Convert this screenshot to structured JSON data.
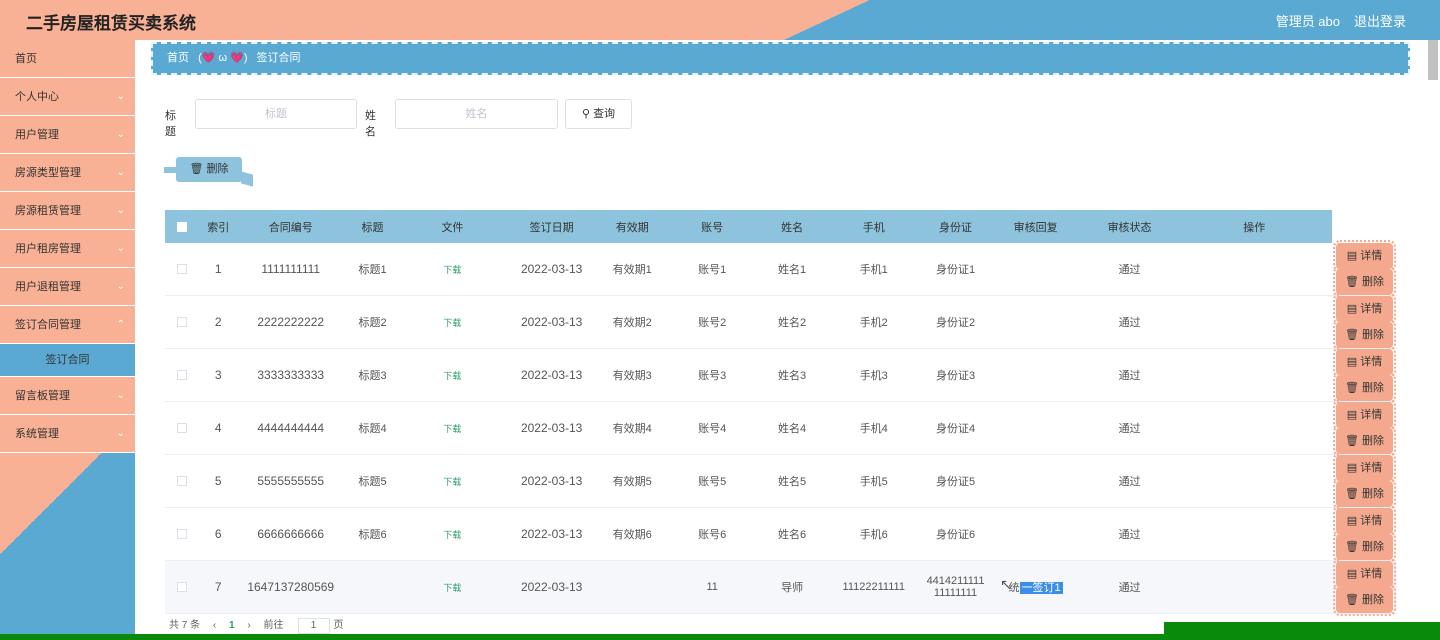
{
  "header": {
    "title": "二手房屋租赁买卖系统",
    "user": "管理员 abo",
    "logout": "退出登录"
  },
  "sidebar": {
    "items": [
      {
        "label": "首页",
        "chevron": false
      },
      {
        "label": "个人中心",
        "chevron": true
      },
      {
        "label": "用户管理",
        "chevron": true
      },
      {
        "label": "房源类型管理",
        "chevron": true
      },
      {
        "label": "房源租赁管理",
        "chevron": true
      },
      {
        "label": "用户租房管理",
        "chevron": true
      },
      {
        "label": "用户退租管理",
        "chevron": true
      },
      {
        "label": "签订合同管理",
        "chevron": true
      }
    ],
    "subitem": "签订合同",
    "items_after": [
      {
        "label": "留言板管理",
        "chevron": true
      },
      {
        "label": "系统管理",
        "chevron": true
      }
    ]
  },
  "breadcrumb": {
    "home": "首页",
    "deco": "(💗 ω 💗)",
    "current": "签订合同"
  },
  "search": {
    "title_label": "标题",
    "title_placeholder": "标题",
    "name_label": "姓名",
    "name_placeholder": "姓名",
    "query_label": "查询"
  },
  "toolbar": {
    "delete_label": "删除"
  },
  "table": {
    "headers": [
      "索引",
      "合同编号",
      "标题",
      "文件",
      "签订日期",
      "有效期",
      "账号",
      "姓名",
      "手机",
      "身份证",
      "审核回复",
      "审核状态",
      "操作"
    ],
    "download_label": "下载",
    "detail_label": "详情",
    "delete_label": "删除",
    "rows": [
      {
        "idx": "1",
        "contract": "1111111111",
        "title": "标题1",
        "date": "2022-03-13",
        "valid": "有效期1",
        "account": "账号1",
        "name": "姓名1",
        "phone": "手机1",
        "idcard": "身份证1",
        "reply": "",
        "status": "通过"
      },
      {
        "idx": "2",
        "contract": "2222222222",
        "title": "标题2",
        "date": "2022-03-13",
        "valid": "有效期2",
        "account": "账号2",
        "name": "姓名2",
        "phone": "手机2",
        "idcard": "身份证2",
        "reply": "",
        "status": "通过"
      },
      {
        "idx": "3",
        "contract": "3333333333",
        "title": "标题3",
        "date": "2022-03-13",
        "valid": "有效期3",
        "account": "账号3",
        "name": "姓名3",
        "phone": "手机3",
        "idcard": "身份证3",
        "reply": "",
        "status": "通过"
      },
      {
        "idx": "4",
        "contract": "4444444444",
        "title": "标题4",
        "date": "2022-03-13",
        "valid": "有效期4",
        "account": "账号4",
        "name": "姓名4",
        "phone": "手机4",
        "idcard": "身份证4",
        "reply": "",
        "status": "通过"
      },
      {
        "idx": "5",
        "contract": "5555555555",
        "title": "标题5",
        "date": "2022-03-13",
        "valid": "有效期5",
        "account": "账号5",
        "name": "姓名5",
        "phone": "手机5",
        "idcard": "身份证5",
        "reply": "",
        "status": "通过"
      },
      {
        "idx": "6",
        "contract": "6666666666",
        "title": "标题6",
        "date": "2022-03-13",
        "valid": "有效期6",
        "account": "账号6",
        "name": "姓名6",
        "phone": "手机6",
        "idcard": "身份证6",
        "reply": "",
        "status": "通过"
      },
      {
        "idx": "7",
        "contract": "1647137280569",
        "title": "",
        "date": "2022-03-13",
        "valid": "",
        "account": "11",
        "name": "导师",
        "phone": "11122211111",
        "idcard": "441421111111111111",
        "reply_prefix": "统",
        "reply_selected": "一签订1",
        "status": "通过"
      }
    ]
  },
  "pager": {
    "total": "共 7 条",
    "prev": "‹",
    "page": "1",
    "next": "›",
    "goto": "前往",
    "goto_value": "1",
    "page_unit": "页"
  }
}
